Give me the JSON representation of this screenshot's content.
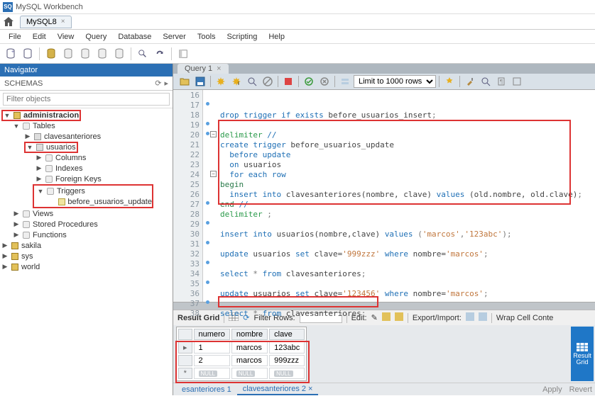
{
  "app": {
    "title": "MySQL Workbench",
    "doc_tab": "MySQL8"
  },
  "menu": {
    "file": "File",
    "edit": "Edit",
    "view": "View",
    "query": "Query",
    "database": "Database",
    "server": "Server",
    "tools": "Tools",
    "scripting": "Scripting",
    "help": "Help"
  },
  "nav": {
    "header": "Navigator",
    "schemas_label": "SCHEMAS",
    "filter_placeholder": "Filter objects",
    "tree": {
      "administracion": "administracion",
      "tables": "Tables",
      "clavesanteriores": "clavesanteriores",
      "usuarios": "usuarios",
      "columns": "Columns",
      "indexes": "Indexes",
      "foreign_keys": "Foreign Keys",
      "triggers": "Triggers",
      "before_usuarios_update": "before_usuarios_update",
      "views": "Views",
      "stored_procedures": "Stored Procedures",
      "functions": "Functions",
      "sakila": "sakila",
      "sys": "sys",
      "world": "world"
    }
  },
  "query_tab": "Query 1",
  "editor": {
    "limit_label": "Limit to 1000 rows",
    "lines": {
      "l16": "16",
      "l17": "17",
      "l18": "18",
      "l19": "19",
      "l20": "20",
      "l21": "21",
      "l22": "22",
      "l23": "23",
      "l24": "24",
      "l25": "25",
      "l26": "26",
      "l27": "27",
      "l28": "28",
      "l29": "29",
      "l30": "30",
      "l31": "31",
      "l32": "32",
      "l33": "33",
      "l34": "34",
      "l35": "35",
      "l36": "36",
      "l37": "37",
      "l38": "38"
    },
    "code": {
      "drop": "drop trigger if exists",
      "drop_target": "before_usuarios_insert",
      "semi": ";",
      "delim_open": "delimiter",
      "slash2": "//",
      "create": "create trigger",
      "trg_name": "before_usuarios_update",
      "before": "before update",
      "on": "on",
      "on_tbl": "usuarios",
      "for_each": "for each row",
      "begin": "begin",
      "insert_into": "insert into",
      "ins_tbl": "clavesanteriores(nombre, clave)",
      "values_kw": "values",
      "ins_vals": "(old.nombre, old.clave)",
      "end": "end",
      "delim_close": "delimiter",
      "delim_semi": ";",
      "ins2": "insert into",
      "ins2_tbl": "usuarios(nombre,clave)",
      "ins2_vk": "values",
      "ins2_open": "(",
      "ins2_s1": "'marcos'",
      "ins2_c": ",",
      "ins2_s2": "'123abc'",
      "ins2_close": ");",
      "upd1": "update",
      "upd1_tbl": "usuarios",
      "set": "set",
      "upd1_assign": "clave=",
      "upd1_val": "'999zzz'",
      "where": "where",
      "upd1_cond": "nombre=",
      "upd1_nm": "'marcos'",
      "sel": "select",
      "star": "*",
      "from": "from",
      "sel_tbl": "clavesanteriores",
      "upd2_val": "'123456'"
    }
  },
  "result": {
    "grid_label": "Result Grid",
    "filter_label": "Filter Rows:",
    "edit_label": "Edit:",
    "export_label": "Export/Import:",
    "wrap_label": "Wrap Cell Conte",
    "side_btn": "Result Grid",
    "headers": {
      "numero": "numero",
      "nombre": "nombre",
      "clave": "clave"
    },
    "rows": [
      {
        "numero": "1",
        "nombre": "marcos",
        "clave": "123abc"
      },
      {
        "numero": "2",
        "nombre": "marcos",
        "clave": "999zzz"
      }
    ],
    "null_label": "NULL",
    "tabs": {
      "t1": "esanteriores 1",
      "t2": "clavesanteriores 2"
    },
    "apply": "Apply",
    "revert": "Revert"
  }
}
